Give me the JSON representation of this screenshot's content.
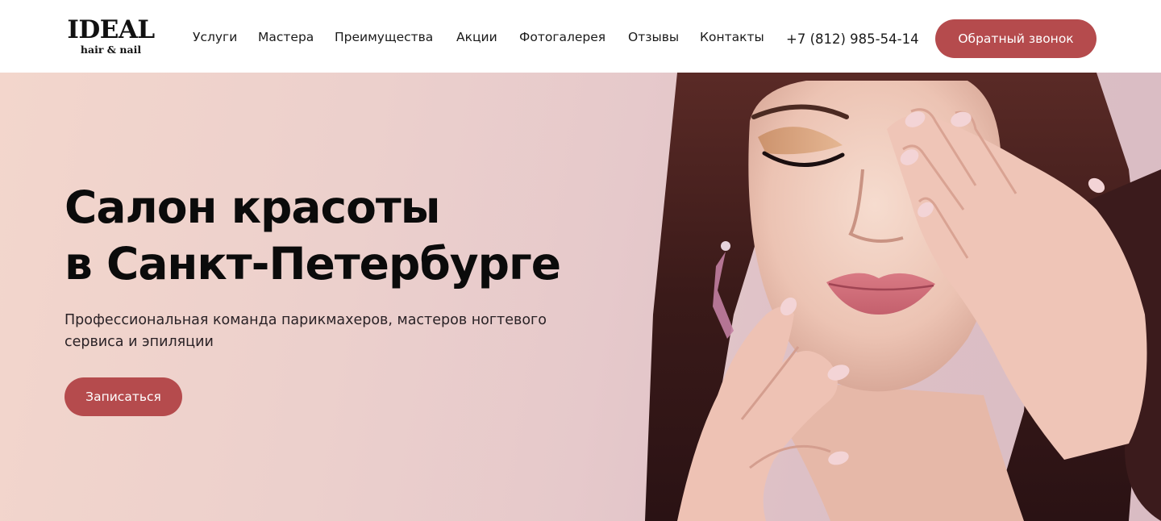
{
  "logo": {
    "main": "IDEAL",
    "sub": "hair & nail"
  },
  "nav": {
    "items": [
      {
        "label": "Услуги"
      },
      {
        "label": "Мастера"
      },
      {
        "label": "Преимущества"
      },
      {
        "label": "Акции"
      },
      {
        "label": "Фотогалерея"
      },
      {
        "label": "Отзывы"
      },
      {
        "label": "Контакты"
      }
    ]
  },
  "header": {
    "phone": "+7 (812) 985-54-14",
    "callback_label": "Обратный звонок"
  },
  "hero": {
    "title_line1": "Салон красоты",
    "title_line2": "в Санкт-Петербурге",
    "subtitle": "Профессиональная команда парикмахеров, мастеров ногтевого сервиса и эпиляции",
    "cta_label": "Записаться",
    "image": "woman-portrait-image"
  },
  "colors": {
    "accent": "#b54b4d",
    "hero_bg_left": "#f3d6cc",
    "hero_bg_right": "#d9bcc3",
    "text": "#0b0b0b"
  }
}
